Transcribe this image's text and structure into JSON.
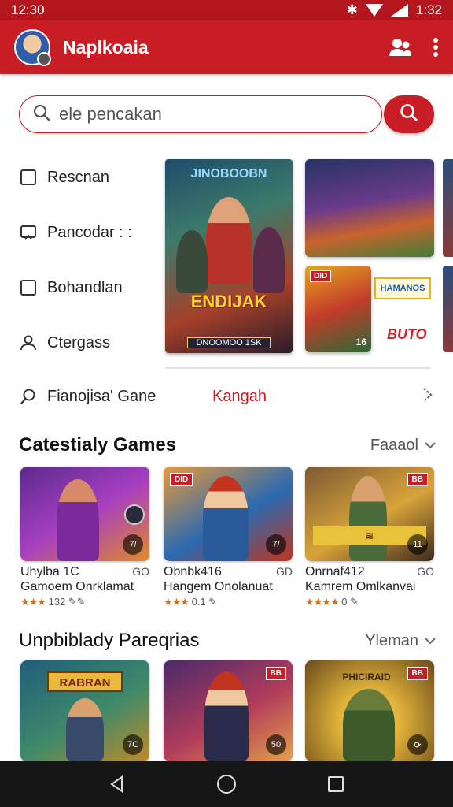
{
  "status_bar": {
    "time_left": "12:30",
    "time_right": "1:32",
    "icons": [
      "bluetooth-icon",
      "wifi-icon",
      "signal-icon"
    ]
  },
  "app_bar": {
    "title": "Naplkoaia",
    "actions": [
      "friends-icon",
      "more-vert-icon"
    ]
  },
  "search": {
    "placeholder": "ele pencakan",
    "value": ""
  },
  "side_menu": [
    {
      "icon": "checkbox-icon",
      "label": "Rescnan"
    },
    {
      "icon": "cast-icon",
      "label": "Pancodar : :"
    },
    {
      "icon": "checkbox-icon",
      "label": "Bohandlan"
    },
    {
      "icon": "person-icon",
      "label": "Ctergass"
    }
  ],
  "featured": {
    "big_banner": {
      "top_text": "JINOBOOBN",
      "mid_text": "ENDIJAK",
      "bottom_text": "DNOOMOO 1SK"
    },
    "mid_thumb_badge": "DID",
    "mid_thumb_corner": "16",
    "logo_a": "HAMANOS",
    "logo_b": "BUTO"
  },
  "tag_row": {
    "label": "Fianojisa' Gane",
    "link": "Kangah"
  },
  "section1": {
    "title": "Catestialy Games",
    "sort_label": "Faaaol",
    "cards": [
      {
        "line1": "Uhylba 1C",
        "rating_right": "GO",
        "line2": "Gamoem Onrklamat",
        "stars": "★★★",
        "line3": "132 ✎✎",
        "badge": "",
        "corner": "7/",
        "colors": [
          "#5b2a8c",
          "#a63ec2",
          "#e08a2a"
        ]
      },
      {
        "line1": "Obnbk416",
        "rating_right": "GD",
        "line2": "Hangem Onolanuat",
        "stars": "★★★",
        "line3": "0.1 ✎",
        "badge": "DID",
        "corner": "7/",
        "colors": [
          "#e89a3a",
          "#2a6ab0",
          "#c2341f"
        ]
      },
      {
        "line1": "Onrnaf412",
        "rating_right": "GO",
        "line2": "Kamrem Omlkanvai",
        "stars": "★★★★",
        "line3": "0 ✎",
        "badge": "BB",
        "corner": "11",
        "colors": [
          "#7b5a34",
          "#d9a33a",
          "#3a2b1c"
        ]
      }
    ]
  },
  "section2": {
    "title": "Unpbiblady Pareqrias",
    "sort_label": "Yleman",
    "cards": [
      {
        "badge": "",
        "corner": "7C",
        "logo": "RABRAN",
        "colors": [
          "#1f5e7a",
          "#3e8a6a",
          "#c08a2a"
        ]
      },
      {
        "badge": "BB",
        "corner": "50",
        "logo": "",
        "colors": [
          "#4a2a6a",
          "#b23c5a",
          "#e3a04a"
        ]
      },
      {
        "badge": "BB",
        "corner": "⟳",
        "logo": "PHICIRAID",
        "colors": [
          "#6a4a1a",
          "#e0b23a",
          "#3c5a2a"
        ]
      }
    ]
  },
  "nav": {
    "buttons": [
      "back-icon",
      "home-icon",
      "recents-icon"
    ]
  },
  "colors": {
    "primary": "#c81d25",
    "status": "#b3161d",
    "star": "#d86a1c"
  }
}
